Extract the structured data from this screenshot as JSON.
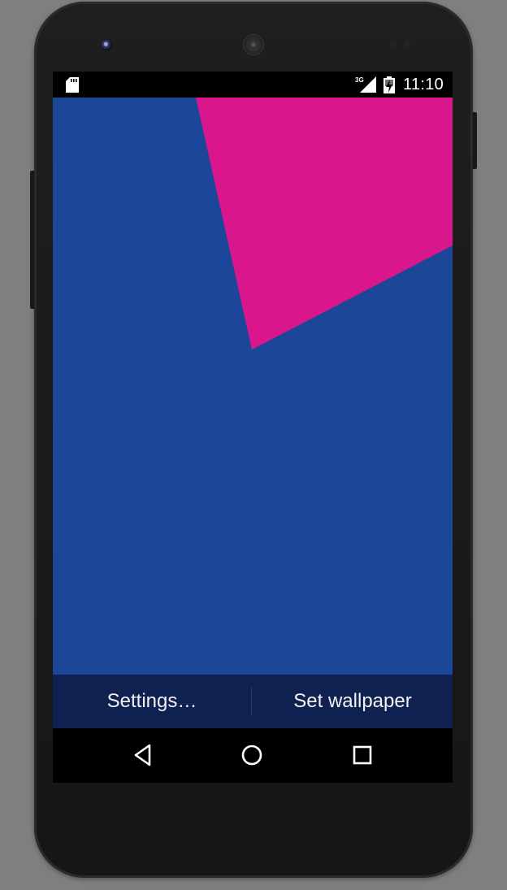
{
  "status_bar": {
    "network_label": "3G",
    "time": "11:10",
    "icons": [
      "sd-card-icon",
      "signal-icon",
      "battery-charging-icon"
    ]
  },
  "wallpaper": {
    "background_color": "#1c4698",
    "shape_color": "#d9168b"
  },
  "actions": {
    "settings_label": "Settings…",
    "set_wallpaper_label": "Set wallpaper"
  },
  "navigation": {
    "icons": [
      "back-icon",
      "home-icon",
      "recents-icon"
    ]
  }
}
